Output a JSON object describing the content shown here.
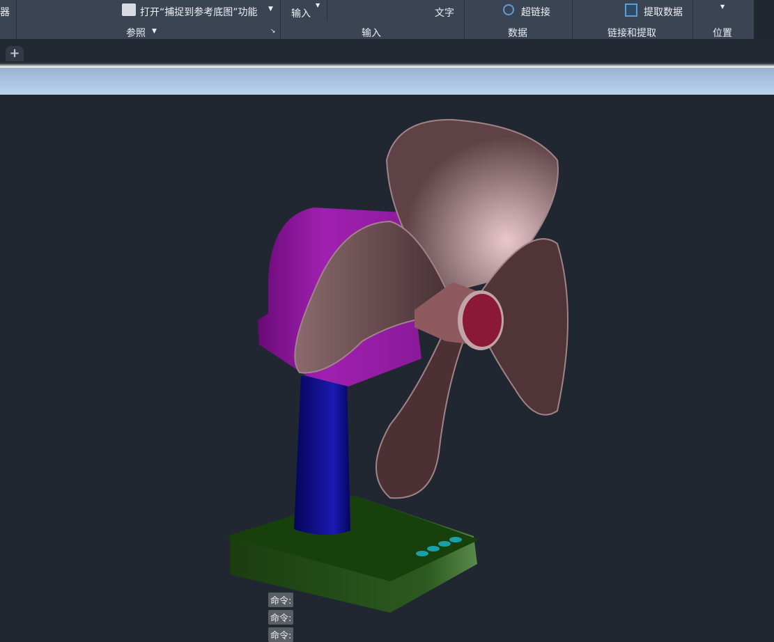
{
  "ribbon": {
    "left_label": "器",
    "reference_button": "打开“捕捉到参考底图”功能",
    "reference_panel": "参照",
    "pdf_import": "输入",
    "merge_text": "文字",
    "input_panel": "输入",
    "hyperlink": "超链接",
    "data_panel": "数据",
    "extract_data": "提取数据",
    "link_extract_panel": "链接和提取",
    "location_panel": "位置"
  },
  "tabs": {
    "new_tab": "+"
  },
  "command_lines": [
    "命令:",
    "命令:",
    "命令:"
  ],
  "colors": {
    "ribbon": "#3b4453",
    "viewport": "#212730",
    "fan_blade": "#6b4a4e",
    "fan_housing": "#8a1f9a",
    "stand": "#0c0c7a",
    "base": "#1f4a12"
  }
}
